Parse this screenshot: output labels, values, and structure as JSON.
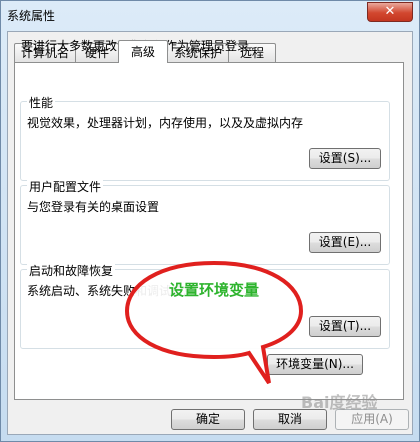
{
  "window": {
    "title": "系统属性",
    "close_glyph": "✕"
  },
  "tabs": [
    "计算机名",
    "硬件",
    "高级",
    "系统保护",
    "远程"
  ],
  "active_tab": "高级",
  "notice": "要进行大多数更改，您必须作为管理员登录。",
  "groups": [
    {
      "title": "性能",
      "desc": "视觉效果，处理器计划，内存使用，以及及虚拟内存",
      "button": "设置(S)..."
    },
    {
      "title": "用户配置文件",
      "desc": "与您登录有关的桌面设置",
      "button": "设置(E)..."
    },
    {
      "title": "启动和故障恢复",
      "desc": "系统启动、系统失败和调试信息",
      "button": "设置(T)..."
    }
  ],
  "env_button": "环境变量(N)...",
  "footer_buttons": {
    "ok": "确定",
    "cancel": "取消",
    "apply": "应用(A)"
  },
  "annotation": {
    "text": "设置环境变量",
    "color": "#2eb42e",
    "outline_color": "#e0201e"
  },
  "watermark": "Bai度经验"
}
